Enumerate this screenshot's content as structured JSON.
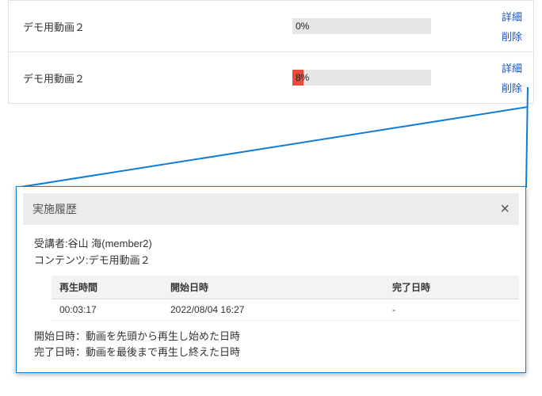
{
  "list": {
    "rows": [
      {
        "title": "デモ用動画２",
        "progress_percent": 0,
        "progress_label": "0%",
        "detail_label": "詳細",
        "delete_label": "削除"
      },
      {
        "title": "デモ用動画２",
        "progress_percent": 8,
        "progress_label": "8%",
        "detail_label": "詳細",
        "delete_label": "削除"
      }
    ]
  },
  "detail": {
    "title": "実施履歴",
    "learner_label": "受講者:",
    "learner_value": "谷山 海(member2)",
    "content_label": "コンテンツ:",
    "content_value": "デモ用動画２",
    "columns": {
      "play_time": "再生時間",
      "start_dt": "開始日時",
      "end_dt": "完了日時"
    },
    "history": [
      {
        "play_time": "00:03:17",
        "start_dt": "2022/08/04 16:27",
        "end_dt": "-"
      }
    ],
    "note_start": "開始日時：動画を先頭から再生し始めた日時",
    "note_end": "完了日時：動画を最後まで再生し終えた日時"
  }
}
